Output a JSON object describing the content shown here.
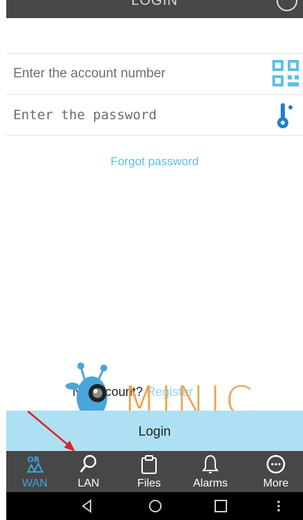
{
  "header": {
    "title": "LOGIN"
  },
  "account": {
    "placeholder": "Enter the account number"
  },
  "password": {
    "placeholder": "Enter the password"
  },
  "forgot_label": "Forgot password",
  "register": {
    "prefix": "No account?",
    "link_label": "Register"
  },
  "login_button_label": "Login",
  "watermark_text": "MINIC",
  "nav": {
    "items": [
      {
        "label": "WAN",
        "icon": "wan-icon",
        "active": true
      },
      {
        "label": "LAN",
        "icon": "search-icon",
        "active": false
      },
      {
        "label": "Files",
        "icon": "clipboard-icon",
        "active": false
      },
      {
        "label": "Alarms",
        "icon": "bell-icon",
        "active": false
      },
      {
        "label": "More",
        "icon": "more-icon",
        "active": false
      }
    ]
  },
  "colors": {
    "accent": "#5cc2e4",
    "active_nav": "#3aa6dd",
    "header_bg": "#474747",
    "login_button_bg": "#aee0f3",
    "watermark": "#f0a24a",
    "annotation_arrow": "#e02020"
  }
}
